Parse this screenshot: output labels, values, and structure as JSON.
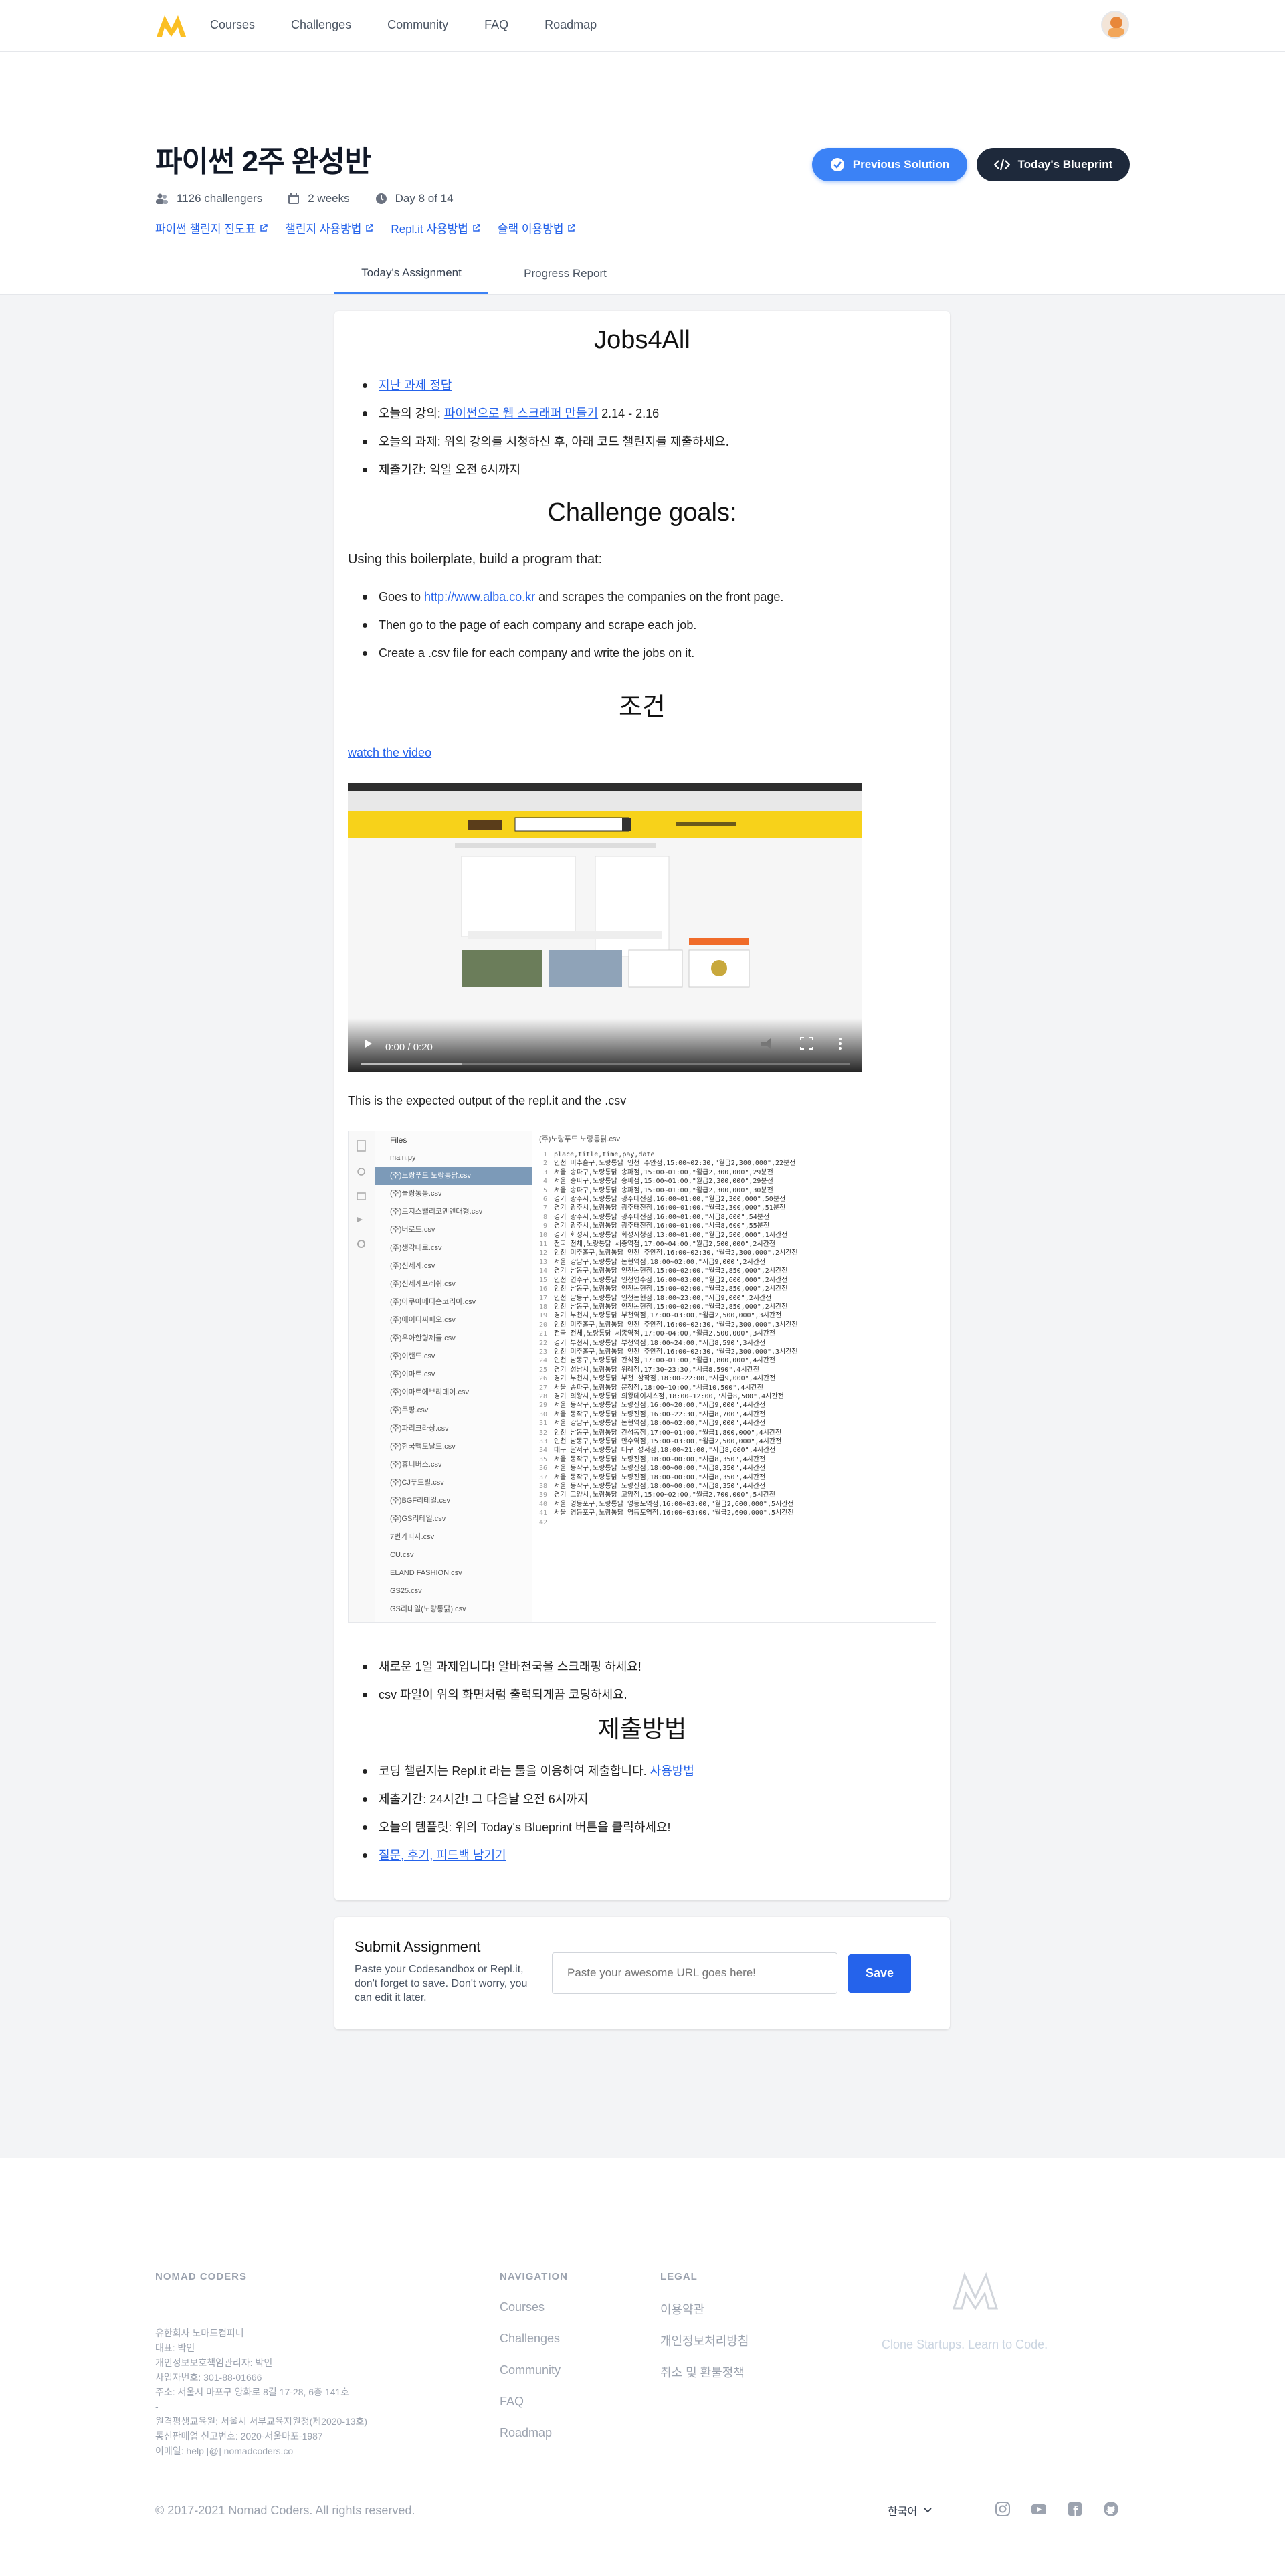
{
  "nav": {
    "links": [
      "Courses",
      "Challenges",
      "Community",
      "FAQ",
      "Roadmap"
    ]
  },
  "hero": {
    "title": "파이썬 2주 완성반",
    "challengers": "1126 challengers",
    "duration": "2 weeks",
    "day": "Day 8 of 14",
    "links": [
      "파이썬 챌린지 진도표",
      "챌린지 사용방법",
      "Repl.it 사용방법",
      "슬랙 이용방법"
    ],
    "prev_button": "Previous Solution",
    "blueprint_button": "Today's Blueprint"
  },
  "tabs": [
    "Today's Assignment",
    "Progress Report"
  ],
  "assignment": {
    "title": "Jobs4All",
    "intro": [
      {
        "link": "지난 과제 정답"
      },
      {
        "pre": "오늘의 강의: ",
        "link": "파이썬으로 웹 스크래퍼 만들기",
        "post": " 2.14 - 2.16"
      },
      {
        "text": "오늘의 과제: 위의 강의를 시청하신 후, 아래 코드 챌린지를 제출하세요."
      },
      {
        "text": "제출기간: 익일 오전 6시까지"
      }
    ],
    "goals_title": "Challenge goals:",
    "boilerplate_text": "Using this boilerplate, build a program that:",
    "goals": [
      {
        "pre": "Goes to ",
        "link": "http://www.alba.co.kr",
        "post": " and scrapes the companies on the front page."
      },
      {
        "text": "Then go to the page of each company and scrape each job."
      },
      {
        "text": "Create a .csv file for each company and write the jobs on it."
      }
    ],
    "conditions_title": "조건",
    "watch_link": "watch the video",
    "video_time": "0:00 / 0:20",
    "expected_text": "This is the expected output of the repl.it and the .csv",
    "repl": {
      "files_header": "Files",
      "open_tab": "(주)노랑푸드 노랑통닭.csv",
      "files": [
        "main.py",
        "(주)노랑푸드 노랑통닭.csv",
        "(주)놀랑통통.csv",
        "(주)로지스밸리코앤엔대형.csv",
        "(주)버로드.csv",
        "(주)생각대로.csv",
        "(주)신세계.csv",
        "(주)신세계프레쉬.csv",
        "(주)아쿠아메디슨코리아.csv",
        "(주)에이디씨피오.csv",
        "(주)우아한형제들.csv",
        "(주)이랜드.csv",
        "(주)이마트.csv",
        "(주)이마트에브리데이.csv",
        "(주)쿠팡.csv",
        "(주)파리크라상.csv",
        "(주)한국맥도날드.csv",
        "(주)휴니버스.csv",
        "(주)CJ푸드빌.csv",
        "(주)BGF리테일.csv",
        "(주)GS리테일.csv",
        "7번가피자.csv",
        "CU.csv",
        "ELAND FASHION.csv",
        "GS25.csv",
        "GS리테일(노랑통닭).csv",
        "GS수퍼마켓.csv"
      ],
      "lines": [
        "place,title,time,pay,date",
        "인천 미추홀구,노랑통닭 인천 주안점,15:00~02:30,\"월급2,300,000\",22분전",
        "서울 송파구,노랑통닭 송파점,15:00~01:00,\"월급2,300,000\",29분전",
        "서울 송파구,노랑통닭 송파점,15:00~01:00,\"월급2,300,000\",29분전",
        "서울 송파구,노랑통닭 송파점,15:00~01:00,\"월급2,300,000\",30분전",
        "경기 광주시,노랑통닭 광주태전점,16:00~01:00,\"월급2,300,000\",50분전",
        "경기 광주시,노랑통닭 광주태전점,16:00~01:00,\"월급2,300,000\",51분전",
        "경기 광주시,노랑통닭 광주태전점,16:00~01:00,\"시급8,600\",54분전",
        "경기 광주시,노랑통닭 광주태전점,16:00~01:00,\"시급8,600\",55분전",
        "경기 화성시,노랑통닭 화성시청점,13:00~01:00,\"월급2,500,000\",1시간전",
        "전국 전체,노랑통닭 세종역점,17:00~04:00,\"월급2,500,000\",2시간전",
        "인천 미추홀구,노랑통닭 인천 주안점,16:00~02:30,\"월급2,300,000\",2시간전",
        "서울 강남구,노랑통닭 논현역점,18:00~02:00,\"시급9,000\",2시간전",
        "경기 남동구,노랑통닭 인천논현점,15:00~02:00,\"월급2,850,000\",2시간전",
        "인천 연수구,노랑통닭 인천연수점,16:00~03:00,\"월급2,600,000\",2시간전",
        "인천 남동구,노랑통닭 인천논현점,15:00~02:00,\"월급2,850,000\",2시간전",
        "인천 남동구,노랑통닭 인천논현점,18:00~23:00,\"시급9,000\",2시간전",
        "인천 남동구,노랑통닭 인천논현점,15:00~02:00,\"월급2,850,000\",2시간전",
        "경기 부천시,노랑통닭 부천역점,17:00~03:00,\"월급2,500,000\",3시간전",
        "인천 미추홀구,노랑통닭 인천 주안점,16:00~02:30,\"월급2,300,000\",3시간전",
        "전국 전체,노랑통닭 세종역점,17:00~04:00,\"월급2,500,000\",3시간전",
        "경기 부천시,노랑통닭 부천역점,18:00~24:00,\"시급8,590\",3시간전",
        "인천 미추홀구,노랑통닭 인천 주안점,16:00~02:30,\"월급2,300,000\",3시간전",
        "인천 남동구,노랑통닭 간석점,17:00~01:00,\"월급1,800,000\",4시간전",
        "경기 성남시,노랑통닭 위례점,17:30~23:30,\"시급8,590\",4시간전",
        "경기 부천시,노랑통닭 부천 삼작점,18:00~22:00,\"시급9,000\",4시간전",
        "서울 송파구,노랑통닭 문정점,18:00~10:00,\"시급10,500\",4시간전",
        "경기 의왕시,노랑통닭 의왕데이시스점,18:00~12:00,\"시급8,500\",4시간전",
        "서울 동작구,노랑통닭 노량진점,16:00~20:00,\"시급9,000\",4시간전",
        "서울 동작구,노랑통닭 노량진점,16:00~22:30,\"시급8,700\",4시간전",
        "서울 강남구,노랑통닭 논현역점,18:00~02:00,\"시급9,000\",4시간전",
        "인천 남동구,노랑통닭 간석동점,17:00~01:00,\"월급1,800,000\",4시간전",
        "인천 남동구,노랑통닭 만수역점,15:00~03:00,\"월급2,500,000\",4시간전",
        "대구 달서구,노랑통닭 대구 성서점,18:00~21:00,\"시급8,600\",4시간전",
        "서울 동작구,노랑통닭 노량진점,18:00~00:00,\"시급8,350\",4시간전",
        "서울 동작구,노랑통닭 노량진점,18:00~00:00,\"시급8,350\",4시간전",
        "서울 동작구,노랑통닭 노량진점,18:00~00:00,\"시급8,350\",4시간전",
        "서울 동작구,노랑통닭 노량진점,18:00~00:00,\"시급8,350\",4시간전",
        "경기 고양시,노랑통닭 고양점,15:00~02:00,\"월급2,700,000\",5시간전",
        "서울 영등포구,노랑통닭 영등포역점,16:00~03:00,\"월급2,600,000\",5시간전",
        "서울 영등포구,노랑통닭 영등포역점,16:00~03:00,\"월급2,600,000\",5시간전",
        ""
      ]
    },
    "notes": [
      {
        "text": "새로운 1일 과제입니다! 알바천국을 스크래핑 하세요!"
      },
      {
        "text": "csv 파일이 위의 화면처럼 출력되게끔 코딩하세요."
      }
    ],
    "submit_title": "제출방법",
    "submit_items": [
      {
        "pre": "코딩 챌린지는 Repl.it 라는 툴을 이용하여 제출합니다. ",
        "link": "사용방법"
      },
      {
        "text": "제출기간: 24시간! 그 다음날 오전 6시까지"
      },
      {
        "text": "오늘의 템플릿: 위의 Today's Blueprint 버튼을 클릭하세요!"
      },
      {
        "link": "질문, 후기, 피드백 남기기"
      }
    ]
  },
  "submit": {
    "title": "Submit Assignment",
    "description": "Paste your Codesandbox or Repl.it, don't forget to save. Don't worry, you can edit it later.",
    "placeholder": "Paste your awesome URL goes here!",
    "button": "Save"
  },
  "footer": {
    "company_title": "NOMAD CODERS",
    "company_lines": [
      "유한회사 노마드컴퍼니",
      "대표: 박인",
      "개인정보보호책임관리자: 박인",
      "사업자번호: 301-88-01666",
      "주소: 서울시 마포구 양화로 8길 17-28, 6층 141호",
      "-",
      "원격평생교육원: 서울시 서부교육지원청(제2020-13호)",
      "통신판매업 신고번호: 2020-서울마포-1987",
      "이메일: help [@] nomadcoders.co"
    ],
    "nav_title": "NAVIGATION",
    "nav_links": [
      "Courses",
      "Challenges",
      "Community",
      "FAQ",
      "Roadmap"
    ],
    "legal_title": "LEGAL",
    "legal_links": [
      "이용약관",
      "개인정보처리방침",
      "취소 및 환불정책"
    ],
    "slogan": "Clone Startups. Learn to Code.",
    "copyright": "© 2017-2021 Nomad Coders. All rights reserved.",
    "language": "한국어",
    "social_icons": [
      "instagram-icon",
      "youtube-icon",
      "facebook-icon",
      "github-icon"
    ]
  }
}
